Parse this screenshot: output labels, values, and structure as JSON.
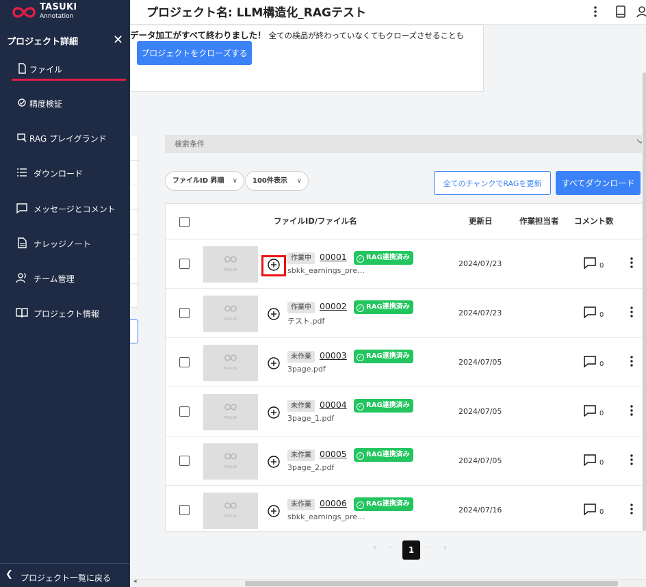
{
  "header": {
    "project_title": "プロジェクト名: LLM構造化_RAGテスト"
  },
  "notice": {
    "lead": "データ加工がすべて終わりました！",
    "detail": "全ての検品が終わっていなくてもクローズさせることも",
    "close_button": "プロジェクトをクローズする"
  },
  "search": {
    "label": "検索条件"
  },
  "controls": {
    "sort_label": "ファイルID 昇順",
    "page_size_label": "100件表示",
    "rag_update_button": "全てのチャンクでRAGを更新",
    "download_all_button": "すべてダウンロード"
  },
  "table": {
    "columns": {
      "file": "ファイルID/ファイル名",
      "updated": "更新日",
      "assignee": "作業担当者",
      "comments": "コメント数"
    },
    "thumb_label": "TASUKI",
    "rag_badge": "RAG連携済み",
    "rows": [
      {
        "status": "作業中",
        "id": "00001",
        "name": "sbkk_earnings_pre…",
        "updated": "2024/07/23",
        "comments": "0"
      },
      {
        "status": "作業中",
        "id": "00002",
        "name": "テスト.pdf",
        "updated": "2024/07/23",
        "comments": "0"
      },
      {
        "status": "未作業",
        "id": "00003",
        "name": "3page.pdf",
        "updated": "2024/07/05",
        "comments": "0"
      },
      {
        "status": "未作業",
        "id": "00004",
        "name": "3page_1.pdf",
        "updated": "2024/07/05",
        "comments": "0"
      },
      {
        "status": "未作業",
        "id": "00005",
        "name": "3page_2.pdf",
        "updated": "2024/07/05",
        "comments": "0"
      },
      {
        "status": "未作業",
        "id": "00006",
        "name": "sbkk_earnings_pre…",
        "updated": "2024/07/16",
        "comments": "0"
      }
    ]
  },
  "pagination": {
    "prev": "‹",
    "ellipsis": "···",
    "current": "1",
    "next": "›"
  },
  "sidebar": {
    "logo_title": "TASUKI",
    "logo_sub": "Annotation",
    "heading": "プロジェクト詳細",
    "items": [
      {
        "label": "ファイル",
        "icon": "file-icon"
      },
      {
        "label": "精度検証",
        "icon": "accuracy-icon"
      },
      {
        "label": "RAG プレイグランド",
        "icon": "playground-icon"
      },
      {
        "label": "ダウンロード",
        "icon": "list-icon"
      },
      {
        "label": "メッセージとコメント",
        "icon": "message-icon"
      },
      {
        "label": "ナレッジノート",
        "icon": "note-icon"
      },
      {
        "label": "チーム管理",
        "icon": "team-icon"
      },
      {
        "label": "プロジェクト情報",
        "icon": "book-icon"
      }
    ],
    "back_label": "プロジェクト一覧に戻る"
  },
  "colors": {
    "sidebar_bg": "#1f2a44",
    "accent": "#3b82f6",
    "active_underline": "#e11d48",
    "rag_badge": "#22c55e"
  }
}
